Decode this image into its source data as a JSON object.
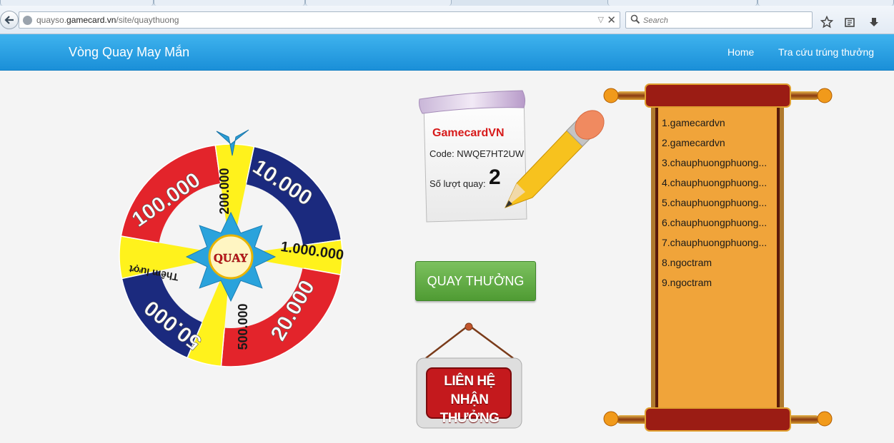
{
  "browser": {
    "url_prefix": "quayso.",
    "url_domain": "gamecard.vn",
    "url_path": "/site/quaythuong",
    "search_placeholder": "Search",
    "icons": [
      "back-arrow-icon",
      "globe-icon",
      "dropdown-arrow-icon",
      "close-icon",
      "search-icon",
      "star-icon",
      "reading-list-icon",
      "download-icon"
    ]
  },
  "header": {
    "brand": "Vòng Quay May Mắn",
    "nav": [
      {
        "label": "Home"
      },
      {
        "label": "Tra cứu trúng thưởng"
      }
    ],
    "colors": {
      "bar_top": "#3fb3ee",
      "bar_bottom": "#1a8fd8"
    }
  },
  "wheel": {
    "center_label": "QUAY",
    "segments": [
      "10.000",
      "1.000.000",
      "20.000",
      "500.000",
      "50.000",
      "Thêm lượt",
      "100.000",
      "200.000"
    ],
    "colors": {
      "red": "#e3242b",
      "navy": "#1b2a7e",
      "yellow": "#fff21c",
      "pointer": "#2a9fd6"
    }
  },
  "card": {
    "name": "GamecardVN",
    "code_label": "Code: NWQE7HT2UW",
    "turns_label": "Số lượt quay:",
    "turns_value": "2"
  },
  "spin_button": {
    "label": "QUAY THƯỞNG",
    "color": "#5fa83f"
  },
  "contact_sign": {
    "line1": "LIÊN HỆ",
    "line2": "NHẬN THƯỞNG"
  },
  "winners": [
    "1.gamecardvn",
    "2.gamecardvn",
    "3.chauphuongphuong...",
    "4.chauphuongphuong...",
    "5.chauphuongphuong...",
    "6.chauphuongphuong...",
    "7.chauphuongphuong...",
    "8.ngoctram",
    "9.ngoctram"
  ]
}
